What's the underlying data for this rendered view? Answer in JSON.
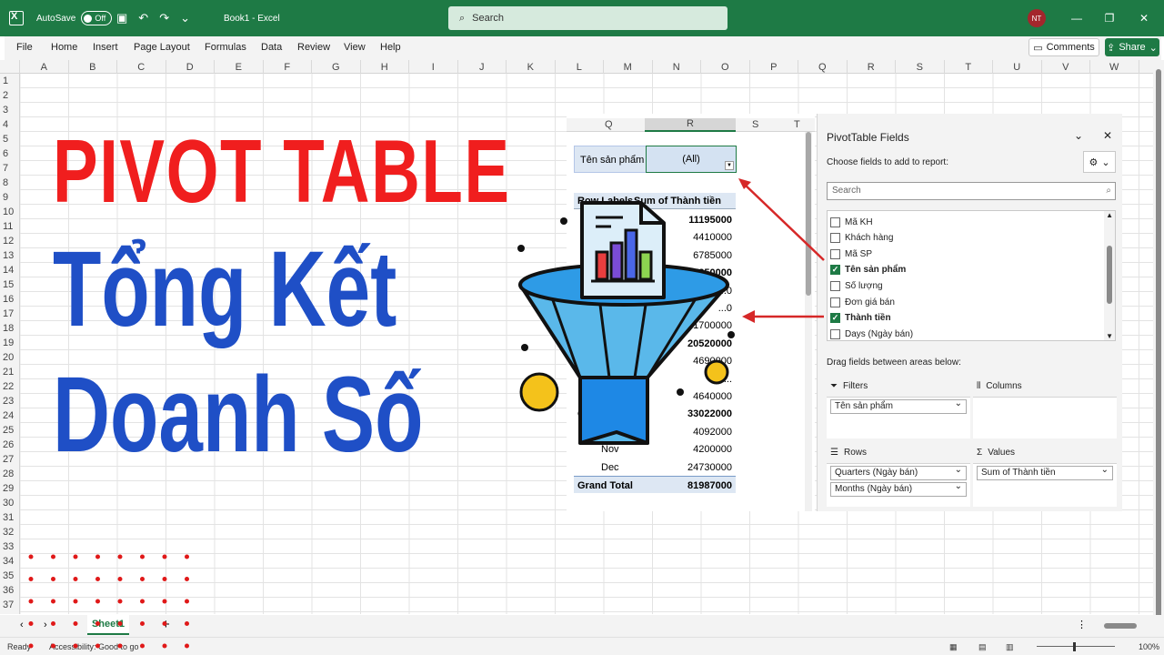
{
  "app": {
    "autosave_label": "AutoSave",
    "autosave_state": "Off",
    "document_title": "Book1  -  Excel",
    "search_placeholder": "Search",
    "user_initials": "NT"
  },
  "ribbon": {
    "tabs": [
      "File",
      "Home",
      "Insert",
      "Page Layout",
      "Formulas",
      "Data",
      "Review",
      "View",
      "Help"
    ],
    "comments_label": "Comments",
    "share_label": "Share"
  },
  "grid": {
    "columns": [
      "A",
      "B",
      "C",
      "D",
      "E",
      "F",
      "G",
      "H",
      "I",
      "J",
      "K",
      "L",
      "M",
      "N",
      "O",
      "P",
      "Q",
      "R",
      "S",
      "T",
      "U",
      "V",
      "W"
    ],
    "rows": [
      "1",
      "2",
      "3",
      "4",
      "5",
      "6",
      "7",
      "8",
      "9",
      "10",
      "11",
      "12",
      "13",
      "14",
      "15",
      "16",
      "17",
      "18",
      "19",
      "20",
      "21",
      "22",
      "23",
      "24",
      "25",
      "26",
      "27",
      "28",
      "29",
      "30",
      "31",
      "32",
      "33",
      "34",
      "35",
      "36",
      "37"
    ]
  },
  "headline": {
    "line1": "PIVOT TABLE",
    "line2": "Tổng Kết",
    "line3": "Doanh Số"
  },
  "pivot": {
    "col_headers": [
      "Q",
      "R",
      "S",
      "T"
    ],
    "filter_label": "Tên sản phẩm",
    "filter_value": "(All)",
    "row_labels_header": "Row Labels",
    "sum_header": "Sum of Thành tiền",
    "values": [
      {
        "label": "",
        "value": "11195000",
        "bold": true
      },
      {
        "label": "",
        "value": "4410000",
        "bold": false
      },
      {
        "label": "",
        "value": "6785000",
        "bold": false
      },
      {
        "label": "",
        "value": "17250000",
        "bold": true
      },
      {
        "label": "",
        "value": "...0",
        "bold": false
      },
      {
        "label": "",
        "value": "...0",
        "bold": false
      },
      {
        "label": "",
        "value": "...1700000",
        "bold": false
      },
      {
        "label": "",
        "value": "20520000",
        "bold": true
      },
      {
        "label": "",
        "value": "4690000",
        "bold": false
      },
      {
        "label": "",
        "value": "11...",
        "bold": false
      },
      {
        "label": "",
        "value": "4640000",
        "bold": false
      },
      {
        "label": "Q...",
        "value": "33022000",
        "bold": true
      },
      {
        "label": "Oct",
        "value": "4092000",
        "bold": false
      },
      {
        "label": "Nov",
        "value": "4200000",
        "bold": false
      },
      {
        "label": "Dec",
        "value": "24730000",
        "bold": false
      }
    ],
    "grand_total_label": "Grand Total",
    "grand_total_value": "81987000"
  },
  "fields_pane": {
    "title": "PivotTable Fields",
    "subtitle": "Choose fields to add to report:",
    "search_placeholder": "Search",
    "fields": [
      {
        "name": "Mã KH",
        "checked": false
      },
      {
        "name": "Khách hàng",
        "checked": false
      },
      {
        "name": "Mã SP",
        "checked": false
      },
      {
        "name": "Tên sản phẩm",
        "checked": true
      },
      {
        "name": "Số lượng",
        "checked": false
      },
      {
        "name": "Đơn giá bán",
        "checked": false
      },
      {
        "name": "Thành tiền",
        "checked": true
      },
      {
        "name": "Days (Ngày bán)",
        "checked": false
      }
    ],
    "drag_label": "Drag fields between areas below:",
    "filters_label": "Filters",
    "columns_label": "Columns",
    "rows_label": "Rows",
    "values_label": "Values",
    "filters_items": [
      "Tên sản phẩm"
    ],
    "rows_items": [
      "Quarters (Ngày bán)",
      "Months (Ngày bán)"
    ],
    "values_items": [
      "Sum of Thành tiền"
    ]
  },
  "sheet_tabs": {
    "active": "Sheet1"
  },
  "status": {
    "ready": "Ready",
    "accessibility": "Accessibility: Good to go",
    "zoom": "100%"
  },
  "colors": {
    "excel_green": "#1e7a45",
    "headline_red": "#f01e1e",
    "headline_blue": "#1f4fc6"
  }
}
